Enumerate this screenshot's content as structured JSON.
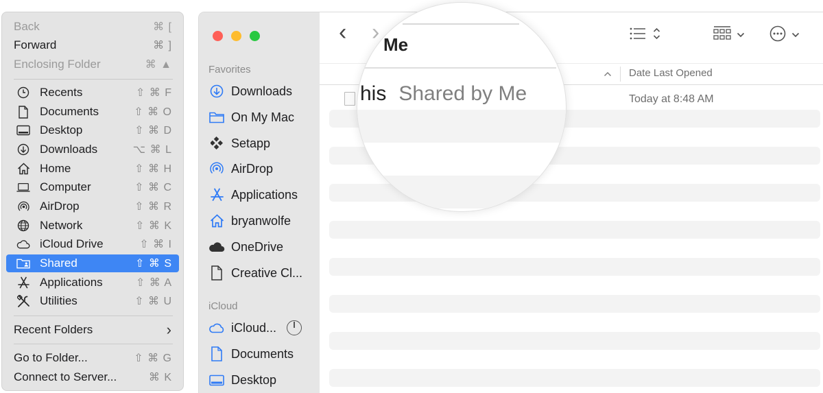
{
  "go_menu": {
    "back": {
      "label": "Back",
      "shortcut": "⌘ ["
    },
    "forward": {
      "label": "Forward",
      "shortcut": "⌘ ]"
    },
    "enclosing": {
      "label": "Enclosing Folder",
      "shortcut": "⌘ ▲"
    },
    "items": [
      {
        "label": "Recents",
        "shortcut": "⇧ ⌘ F",
        "icon": "clock-icon"
      },
      {
        "label": "Documents",
        "shortcut": "⇧ ⌘ O",
        "icon": "document-icon"
      },
      {
        "label": "Desktop",
        "shortcut": "⇧ ⌘ D",
        "icon": "desktop-icon"
      },
      {
        "label": "Downloads",
        "shortcut": "⌥ ⌘ L",
        "icon": "download-icon"
      },
      {
        "label": "Home",
        "shortcut": "⇧ ⌘ H",
        "icon": "home-icon"
      },
      {
        "label": "Computer",
        "shortcut": "⇧ ⌘ C",
        "icon": "laptop-icon"
      },
      {
        "label": "AirDrop",
        "shortcut": "⇧ ⌘ R",
        "icon": "airdrop-icon"
      },
      {
        "label": "Network",
        "shortcut": "⇧ ⌘ K",
        "icon": "globe-icon"
      },
      {
        "label": "iCloud Drive",
        "shortcut": "⇧ ⌘ I",
        "icon": "cloud-icon"
      },
      {
        "label": "Shared",
        "shortcut": "⇧ ⌘ S",
        "icon": "shared-folder-icon"
      },
      {
        "label": "Applications",
        "shortcut": "⇧ ⌘ A",
        "icon": "applications-icon"
      },
      {
        "label": "Utilities",
        "shortcut": "⇧ ⌘ U",
        "icon": "tools-icon"
      }
    ],
    "recent_folders": {
      "label": "Recent Folders",
      "chevron": "›"
    },
    "go_to_folder": {
      "label": "Go to Folder...",
      "shortcut": "⇧ ⌘ G"
    },
    "connect": {
      "label": "Connect to Server...",
      "shortcut": "⌘ K"
    }
  },
  "sidebar": {
    "favorites_header": "Favorites",
    "favorites": [
      {
        "label": "Downloads",
        "icon": "download-icon"
      },
      {
        "label": "On My Mac",
        "icon": "folder-icon"
      },
      {
        "label": "Setapp",
        "icon": "setapp-icon"
      },
      {
        "label": "AirDrop",
        "icon": "airdrop-icon"
      },
      {
        "label": "Applications",
        "icon": "applications-icon"
      },
      {
        "label": "bryanwolfe",
        "icon": "home-icon"
      },
      {
        "label": "OneDrive",
        "icon": "onedrive-icon"
      },
      {
        "label": "Creative Cl...",
        "icon": "file-icon"
      }
    ],
    "icloud_header": "iCloud",
    "icloud": [
      {
        "label": "iCloud...",
        "icon": "cloud-icon"
      },
      {
        "label": "Documents",
        "icon": "document-icon"
      },
      {
        "label": "Desktop",
        "icon": "desktop-icon"
      }
    ]
  },
  "toolbar": {
    "back_icon": "‹",
    "forward_icon": "›"
  },
  "columns": {
    "date_last_opened": "Date Last Opened"
  },
  "rows": [
    {
      "date": "Today at 8:48 AM"
    }
  ],
  "magnifier": {
    "title": "Me",
    "name_fragment": "his",
    "shared_by": "Shared by Me"
  }
}
